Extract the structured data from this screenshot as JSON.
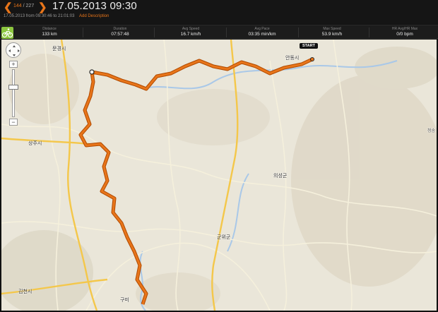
{
  "header": {
    "nav_prev": "❮",
    "nav_next": "❯",
    "current_index": "144",
    "separator": " / ",
    "total": "227",
    "title": "17.05.2013 09:30",
    "date_range": "17.05.2013  from 09:30:46 to 21:01:03",
    "add_description": "Add Description"
  },
  "stats": {
    "sport_icon": "cycling-icon",
    "items": [
      {
        "label": "Distance",
        "value": "133 km"
      },
      {
        "label": "Duration",
        "value": "07:57:48"
      },
      {
        "label": "Avg Speed",
        "value": "16.7 km/h"
      },
      {
        "label": "Avg Pace",
        "value": "03:35 min/km"
      },
      {
        "label": "Max Speed",
        "value": "53.9 km/h"
      },
      {
        "label": "HR Avg/HR Max",
        "value": "0/0 bpm"
      }
    ]
  },
  "map": {
    "start_label": "START",
    "places": [
      {
        "name": "문경시",
        "small": false
      },
      {
        "name": "안동시",
        "small": false
      },
      {
        "name": "상주시",
        "small": false
      },
      {
        "name": "의성군",
        "small": false
      },
      {
        "name": "군위군",
        "small": false
      },
      {
        "name": "김천시",
        "small": false
      },
      {
        "name": "구미",
        "small": false
      },
      {
        "name": "청송",
        "small": true
      }
    ],
    "zoom_in": "+",
    "zoom_out": "−",
    "colors": {
      "route": "#e8751a",
      "route_edge": "#b04a00",
      "accent": "#e8751a",
      "sport_icon_bg": "#8cc63f"
    }
  }
}
